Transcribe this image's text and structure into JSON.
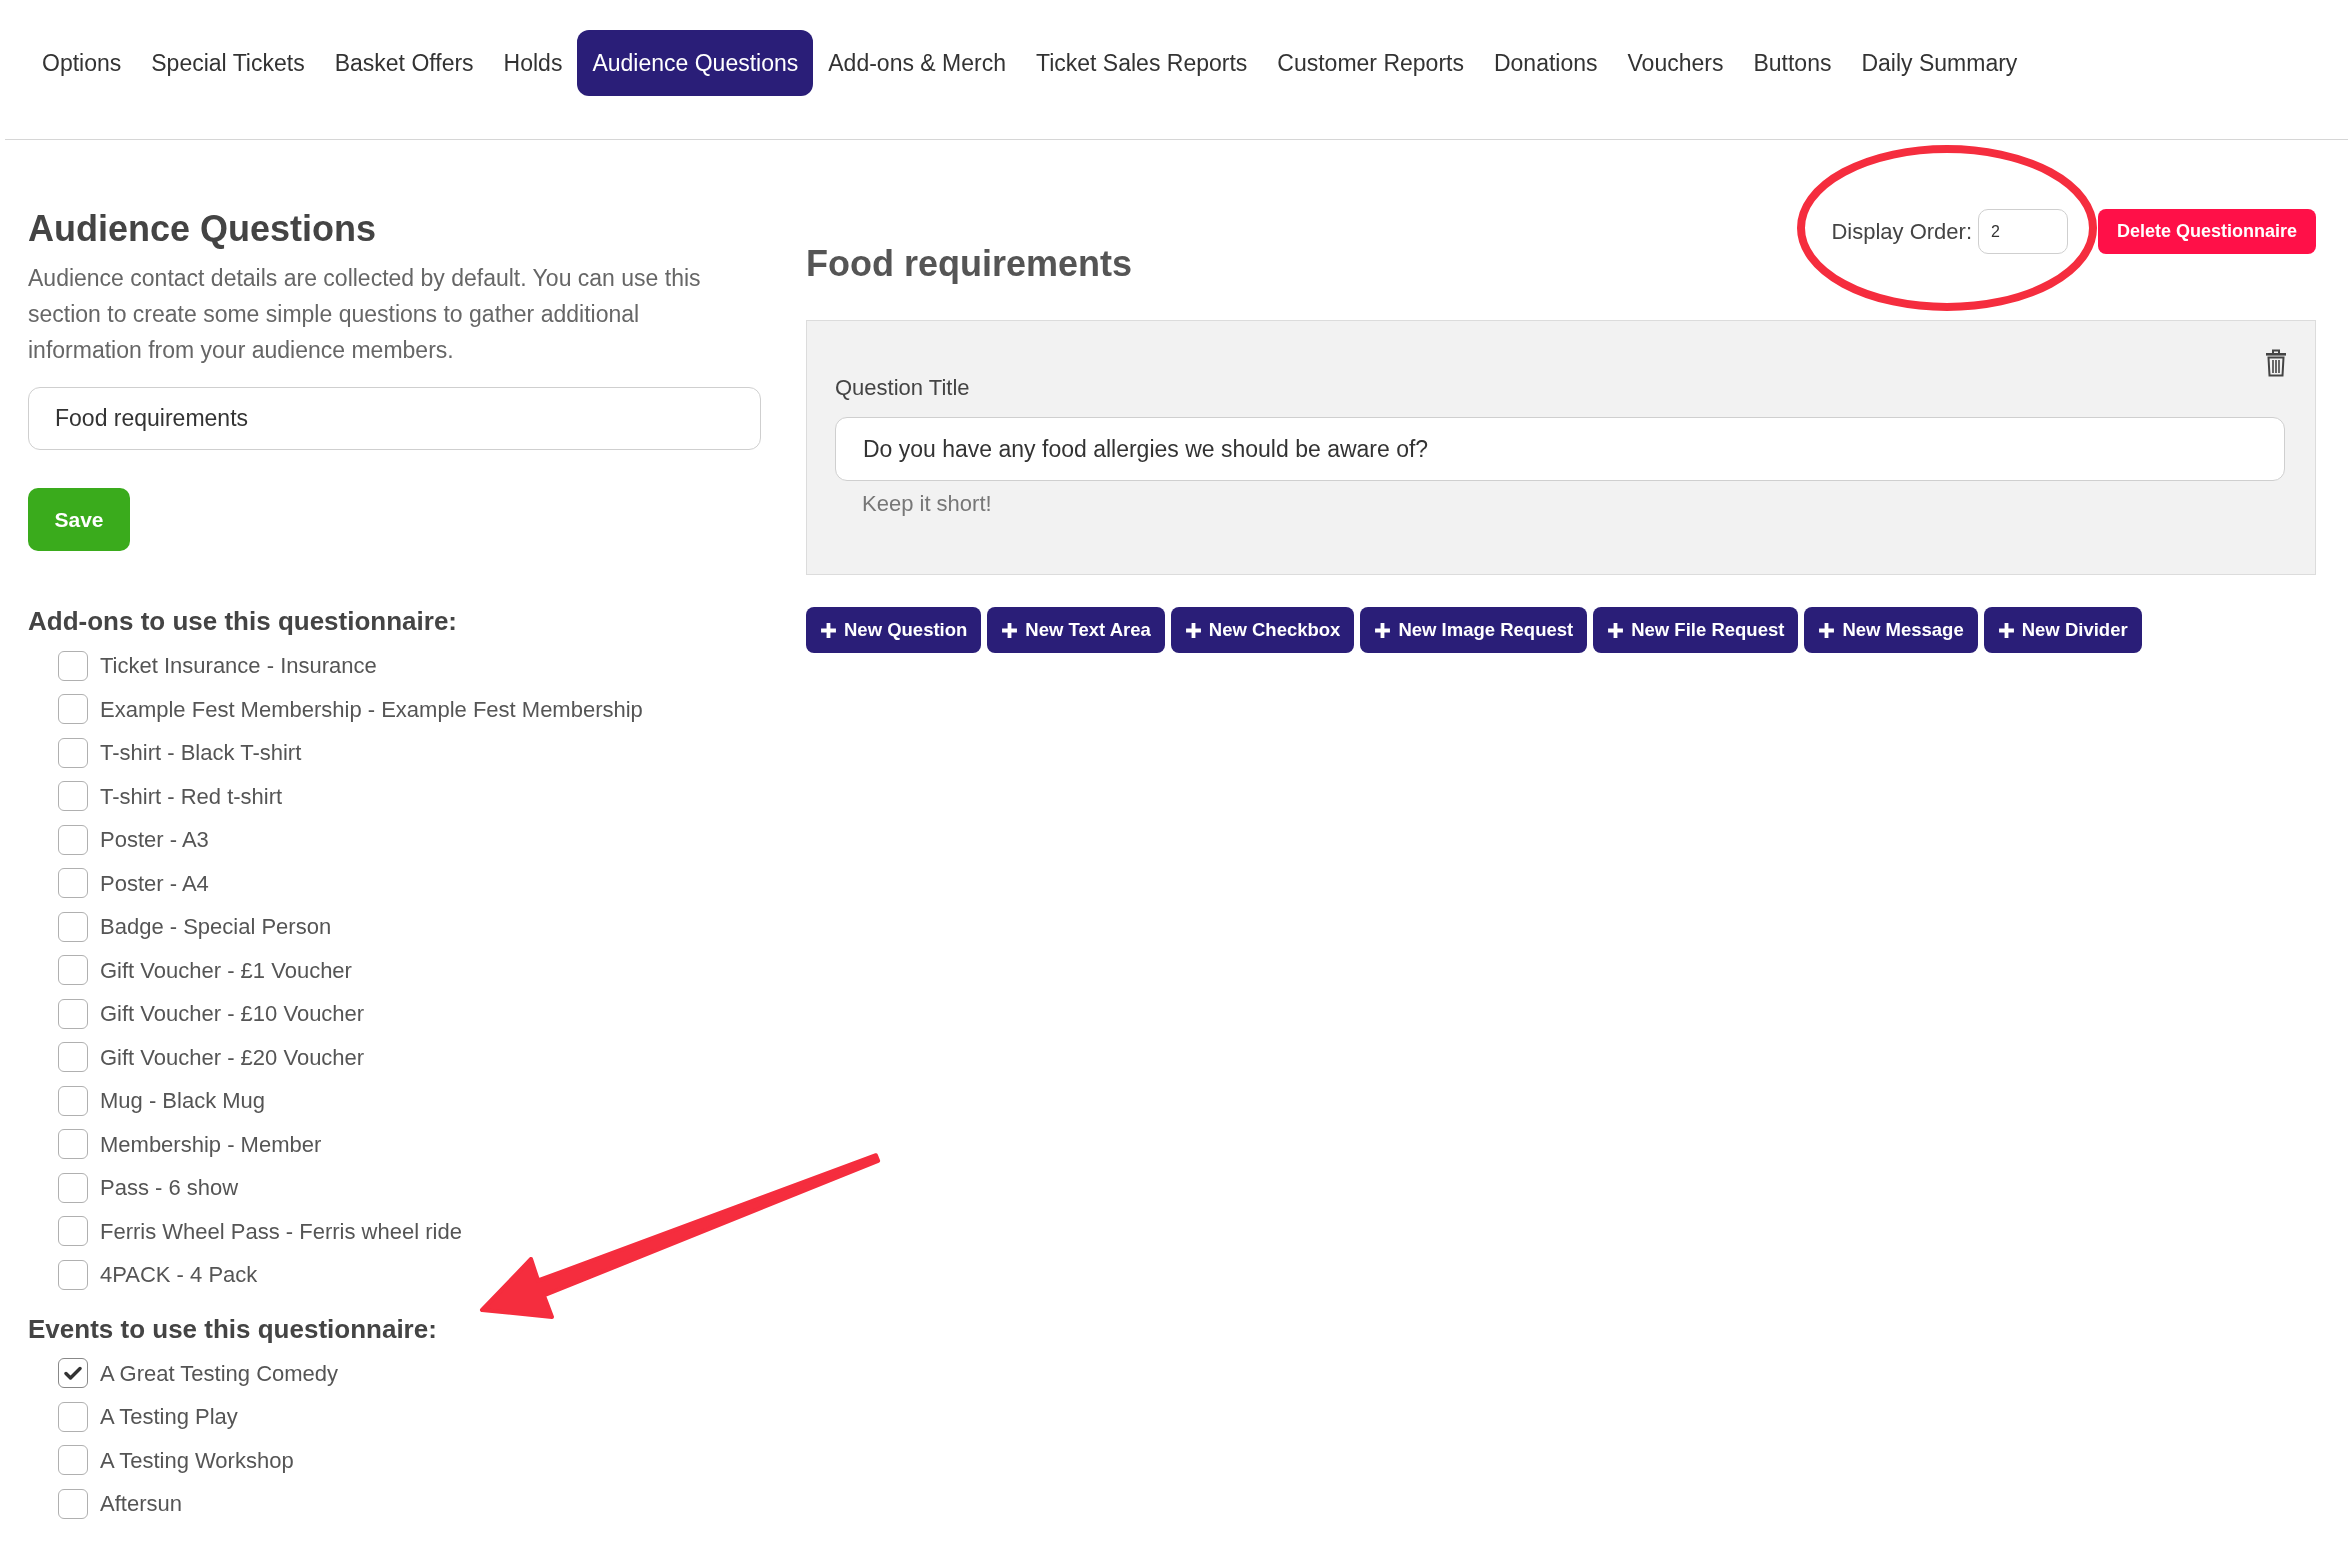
{
  "nav_tabs": [
    {
      "label": "Options",
      "selected": false
    },
    {
      "label": "Special Tickets",
      "selected": false
    },
    {
      "label": "Basket Offers",
      "selected": false
    },
    {
      "label": "Holds",
      "selected": false
    },
    {
      "label": "Audience Questions",
      "selected": true
    },
    {
      "label": "Add-ons & Merch",
      "selected": false
    },
    {
      "label": "Ticket Sales Reports",
      "selected": false
    },
    {
      "label": "Customer Reports",
      "selected": false
    },
    {
      "label": "Donations",
      "selected": false
    },
    {
      "label": "Vouchers",
      "selected": false
    },
    {
      "label": "Buttons",
      "selected": false
    },
    {
      "label": "Daily Summary",
      "selected": false
    }
  ],
  "sidebar": {
    "title": "Audience Questions",
    "description": "Audience contact details are collected by default. You can use this section to create some simple questions to gather additional information from your audience members.",
    "name_field": {
      "value": "Food requirements"
    },
    "save_button": "Save",
    "addons": {
      "heading": "Add-ons to use this questionnaire:",
      "items": [
        {
          "label": "Ticket Insurance - Insurance",
          "checked": false
        },
        {
          "label": "Example Fest Membership - Example Fest Membership",
          "checked": false
        },
        {
          "label": "T-shirt - Black T-shirt",
          "checked": false
        },
        {
          "label": "T-shirt - Red t-shirt",
          "checked": false
        },
        {
          "label": "Poster - A3",
          "checked": false
        },
        {
          "label": "Poster - A4",
          "checked": false
        },
        {
          "label": "Badge - Special Person",
          "checked": false
        },
        {
          "label": "Gift Voucher - £1 Voucher",
          "checked": false
        },
        {
          "label": "Gift Voucher - £10 Voucher",
          "checked": false
        },
        {
          "label": "Gift Voucher - £20 Voucher",
          "checked": false
        },
        {
          "label": "Mug - Black Mug",
          "checked": false
        },
        {
          "label": "Membership - Member",
          "checked": false
        },
        {
          "label": "Pass - 6 show",
          "checked": false
        },
        {
          "label": "Ferris Wheel Pass - Ferris wheel ride",
          "checked": false
        },
        {
          "label": "4PACK - 4 Pack",
          "checked": false
        }
      ]
    },
    "events": {
      "heading": "Events to use this questionnaire:",
      "items": [
        {
          "label": "A Great Testing Comedy",
          "checked": true
        },
        {
          "label": "A Testing Play",
          "checked": false
        },
        {
          "label": "A Testing Workshop",
          "checked": false
        },
        {
          "label": "Aftersun",
          "checked": false
        }
      ]
    }
  },
  "editor": {
    "title": "Food requirements",
    "display_order": {
      "label": "Display Order:",
      "value": "2"
    },
    "delete_button": "Delete Questionnaire",
    "questions": [
      {
        "kind": "question",
        "label": "Question Title",
        "value": "Do you have any food allergies we should be aware of?",
        "help_text": "Keep it short!"
      }
    ],
    "add_buttons": [
      "New Question",
      "New Text Area",
      "New Checkbox",
      "New Image Request",
      "New File Request",
      "New Message",
      "New Divider"
    ]
  },
  "annotations": [
    {
      "kind": "ellipse"
    },
    {
      "kind": "arrow"
    }
  ]
}
